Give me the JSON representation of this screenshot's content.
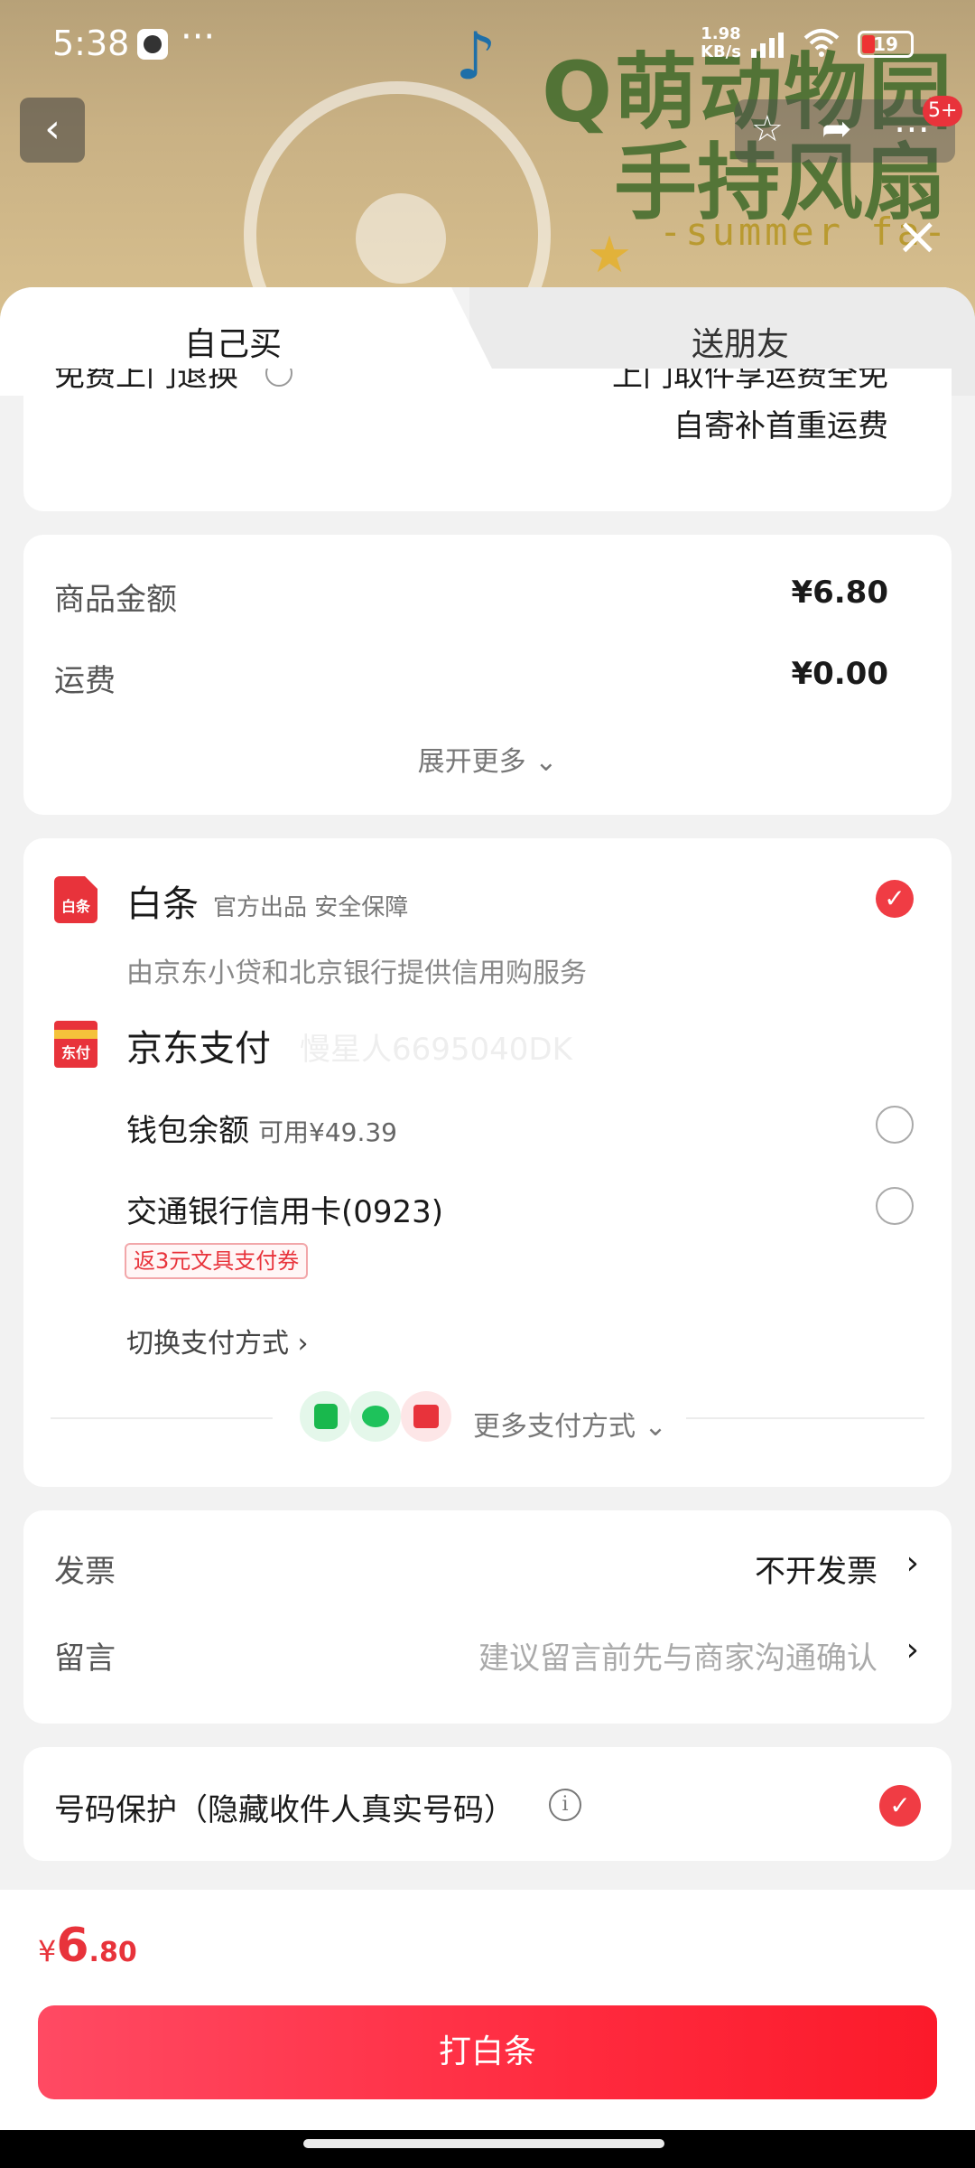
{
  "status_bar": {
    "time": "5:38",
    "more": "···",
    "speed_value": "1.98",
    "speed_unit": "KB/s",
    "battery": "19"
  },
  "banner": {
    "title_line1": "Q萌动物园",
    "title_line2": "手持风扇",
    "subtitle": "-summer fa-"
  },
  "nav": {
    "badge": "5+"
  },
  "tabs": [
    {
      "label": "自己买",
      "active": true
    },
    {
      "label": "送朋友",
      "active": false
    }
  ],
  "return_service": {
    "label": "免费上门退换",
    "line1": "上门取件享运费全免",
    "line2": "自寄补首重运费"
  },
  "amounts": {
    "items": [
      {
        "label": "商品金额",
        "value": "¥6.80"
      },
      {
        "label": "运费",
        "value": "¥0.00"
      }
    ],
    "expand_label": "展开更多"
  },
  "payment": {
    "baitiao": {
      "logo_text": "白条",
      "title": "白条",
      "tags": "官方出品 安全保障",
      "desc": "由京东小贷和北京银行提供信用购服务",
      "selected": true
    },
    "jdpay": {
      "logo_text": "东付",
      "title": "京东支付",
      "account": "慢星人6695040DK"
    },
    "options": [
      {
        "label": "钱包余额",
        "sub": "可用¥49.39",
        "selected": false
      },
      {
        "label": "交通银行信用卡(0923)",
        "sub": "",
        "selected": false
      }
    ],
    "coupon": "返3元文具支付券",
    "switch_label": "切换支付方式",
    "more_label": "更多支付方式"
  },
  "invoice": {
    "label": "发票",
    "value": "不开发票"
  },
  "message": {
    "label": "留言",
    "placeholder": "建议留言前先与商家沟通确认"
  },
  "privacy": {
    "label": "号码保护（隐藏收件人真实号码）",
    "checked": true
  },
  "footer": {
    "price_symbol": "¥",
    "price_int": "6",
    "price_dec": ".80",
    "button_label": "打白条"
  },
  "colors": {
    "accent": "#e8333b",
    "button_start": "#ff4a63",
    "button_end": "#fb1a2a"
  }
}
